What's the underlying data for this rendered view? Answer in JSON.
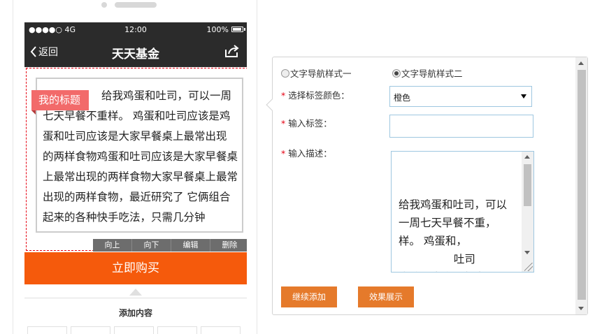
{
  "phone": {
    "status": {
      "signal": "●●●●○ 4G",
      "time": "12:00",
      "battery": "100%"
    },
    "nav": {
      "back_label": "返回",
      "title": "天天基金"
    },
    "module": {
      "tag": "我的标题",
      "text": "给我鸡蛋和吐司，可以一周七天早餐不重样。 鸡蛋和吐司应该是鸡蛋和吐司应该是大家早餐桌上最常出现 的两样食物鸡蛋和吐司应该是大家早餐桌上最常出现的两样食物大家早餐桌上最常出现的两样食物，最近研究了 它俩组合起来的各种快手吃法，只需几分钟",
      "ops": [
        "向上",
        "向下",
        "编辑",
        "删除"
      ]
    },
    "buy_button": "立即购买",
    "add_content": "添加内容"
  },
  "editor": {
    "radio1": "文字导航样式一",
    "radio2": "文字导航样式二",
    "selected_radio": 2,
    "color_label": "选择标签颜色：",
    "color_value": "橙色",
    "tag_label": "输入标签：",
    "tag_value": "",
    "desc_label": "输入描述：",
    "desc_value": "给我鸡蛋和吐司，可以一周七天早餐不重，样。 鸡蛋和，\n                吐司\n应该是大家早餐桌上",
    "continue_button": "继续添加",
    "preview_button": "效果展示"
  },
  "colors": {
    "accent": "#f55a0c",
    "button": "#e57a2b",
    "tag": "#f26a6a",
    "dashed_border": "#e60012",
    "navbar": "#2b2b2b"
  }
}
